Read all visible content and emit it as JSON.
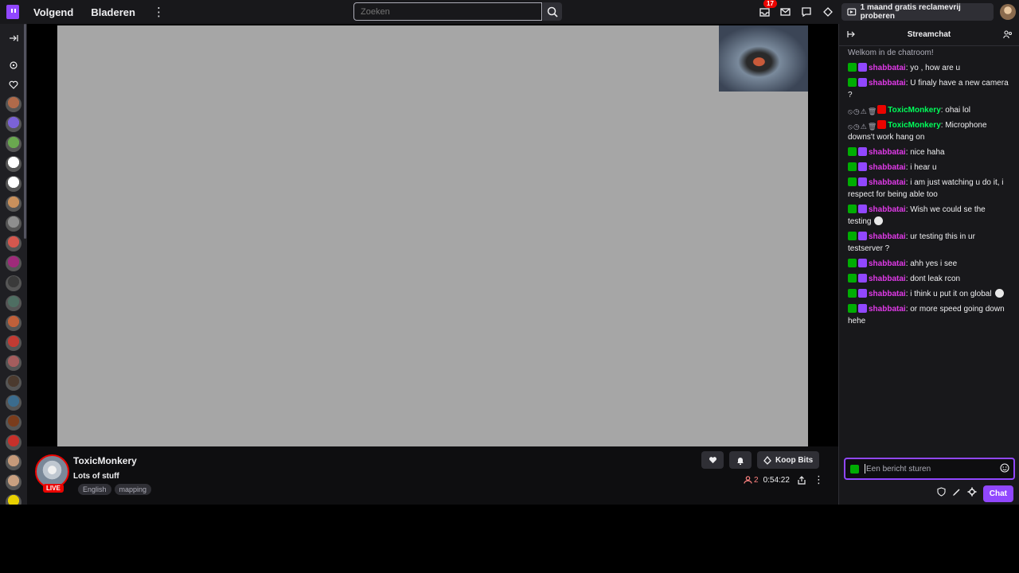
{
  "topbar": {
    "nav": {
      "following": "Volgend",
      "browse": "Bladeren"
    },
    "search": {
      "placeholder": "Zoeken"
    },
    "notifications_count": "17",
    "promo": "1 maand gratis reclamevrij proberen",
    "icons": [
      "twitch-logo-icon",
      "more-vertical-icon",
      "search-icon",
      "inbox-icon",
      "mail-icon",
      "whispers-icon",
      "crown-icon",
      "ad-free-icon"
    ]
  },
  "sidebar": {
    "avatar_colors": [
      "#b06a4a",
      "#7b62d6",
      "#6aa84f",
      "#ffffff",
      "#ffffff",
      "#c9905c",
      "#8e8e8e",
      "#d4574e",
      "#9f2a7a",
      "#3a3a3a",
      "#4e6e62",
      "#c0603a",
      "#c23b33",
      "#a55d5d",
      "#4b3a2e",
      "#3b6c8e",
      "#7a3c1c",
      "#c7302a",
      "#c69a7a",
      "#c9a080",
      "#e8d000"
    ]
  },
  "stream": {
    "channel": "ToxicMonkery",
    "title": "Lots of stuff",
    "live_label": "LIVE",
    "tags": [
      "English",
      "mapping"
    ],
    "bits_label": "Koop Bits",
    "viewers": "2",
    "uptime": "0:54:22"
  },
  "chat": {
    "header": "Streamchat",
    "welcome": "Welkom in de chatroom!",
    "input_placeholder": "Een bericht sturen",
    "send_label": "Chat",
    "messages": [
      {
        "user": "shabbatai",
        "text": ": yo , how are u"
      },
      {
        "user": "shabbatai",
        "text": ": U finaly have a new camera ?"
      },
      {
        "user": "ToxicMonkery",
        "text": ": ohai lol"
      },
      {
        "user": "ToxicMonkery",
        "text": ": Microphone downs't work hang on"
      },
      {
        "user": "shabbatai",
        "text": ": nice haha"
      },
      {
        "user": "shabbatai",
        "text": ": i hear u"
      },
      {
        "user": "shabbatai",
        "text": ": i am just watching u do it, i respect for being able too"
      },
      {
        "user": "shabbatai",
        "text": ": Wish we could se the testing"
      },
      {
        "user": "shabbatai",
        "text": ": ur testing this in ur testserver ?"
      },
      {
        "user": "shabbatai",
        "text": ": ahh yes i see"
      },
      {
        "user": "shabbatai",
        "text": ": dont leak rcon"
      },
      {
        "user": "shabbatai",
        "text": ": i think u put it on global"
      },
      {
        "user": "shabbatai",
        "text": ": or more speed going down hehe"
      }
    ]
  },
  "colors": {
    "accent": "#9147ff",
    "live": "#eb0400",
    "mod": "#00ad03"
  }
}
